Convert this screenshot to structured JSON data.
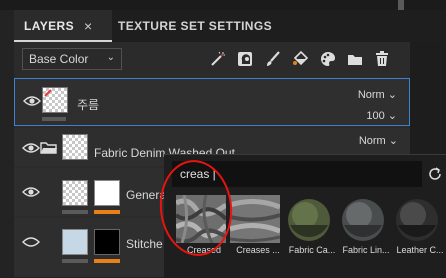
{
  "tabs": [
    {
      "label": "LAYERS",
      "close": "×"
    },
    {
      "label": "TEXTURE SET SETTINGS"
    }
  ],
  "toolbar": {
    "blend_select": "Base Color",
    "icons": [
      "wand-icon",
      "mask-icon",
      "brush-icon",
      "fill-icon",
      "palette-icon",
      "folder-icon",
      "trash-icon"
    ]
  },
  "layers": [
    {
      "name": "주름",
      "blend": "Norm",
      "opacity": "100",
      "selected": true
    },
    {
      "name": "Fabric Denim Washed Out",
      "blend": "Norm",
      "is_folder": true
    },
    {
      "name": "Genera"
    },
    {
      "name": "Stitche"
    }
  ],
  "search": {
    "query": "creas |",
    "results": [
      {
        "label": "Creased"
      },
      {
        "label": "Creases ..."
      },
      {
        "label": "Fabric Ca..."
      },
      {
        "label": "Fabric Lin..."
      },
      {
        "label": "Leather C..."
      }
    ]
  },
  "colors": {
    "accent_blue": "#3d82d1",
    "mask_orange": "#e8801a",
    "highlight_red": "#e8140f"
  }
}
